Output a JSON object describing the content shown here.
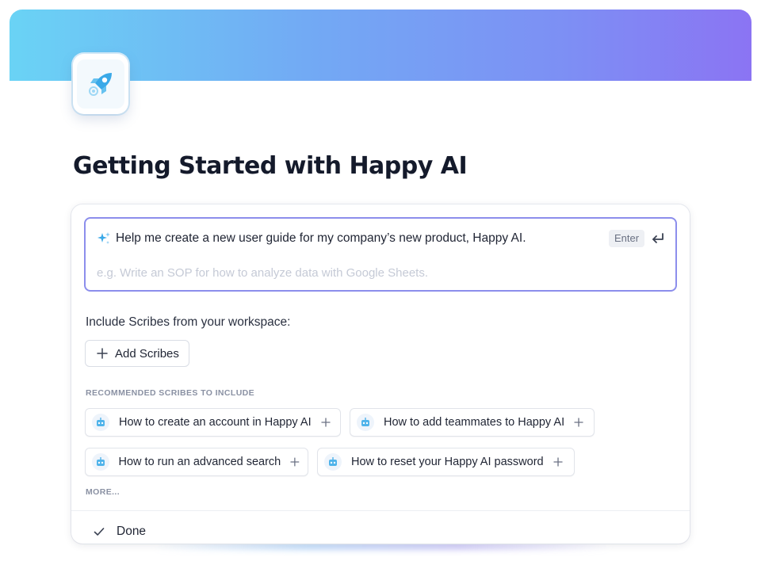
{
  "page": {
    "title": "Getting Started with Happy AI",
    "icon": "rocket-icon"
  },
  "prompt": {
    "icon": "sparkle-icon",
    "text": "Help me create a new user guide for my company’s new product, Happy AI.",
    "enter_label": "Enter",
    "return_icon": "return-arrow-icon",
    "placeholder": "e.g. Write an SOP for how to analyze data with Google Sheets."
  },
  "include": {
    "label": "Include Scribes from your workspace:",
    "add_button_label": "Add Scribes"
  },
  "recommended": {
    "heading": "RECOMMENDED SCRIBES TO INCLUDE",
    "items": [
      {
        "label": "How to create an account in Happy AI",
        "icon": "robot-icon"
      },
      {
        "label": "How to add teammates to Happy AI",
        "icon": "robot-icon"
      },
      {
        "label": "How to run an advanced search",
        "icon": "robot-icon"
      },
      {
        "label": "How to reset your Happy AI password",
        "icon": "robot-icon"
      }
    ],
    "more_label": "MORE..."
  },
  "footer": {
    "done_label": "Done",
    "done_icon": "check-icon"
  },
  "colors": {
    "banner_start": "#6ad3f5",
    "banner_end": "#8b74f3",
    "prompt_border": "#8c8eec",
    "rocket": "#3aa9e8"
  }
}
